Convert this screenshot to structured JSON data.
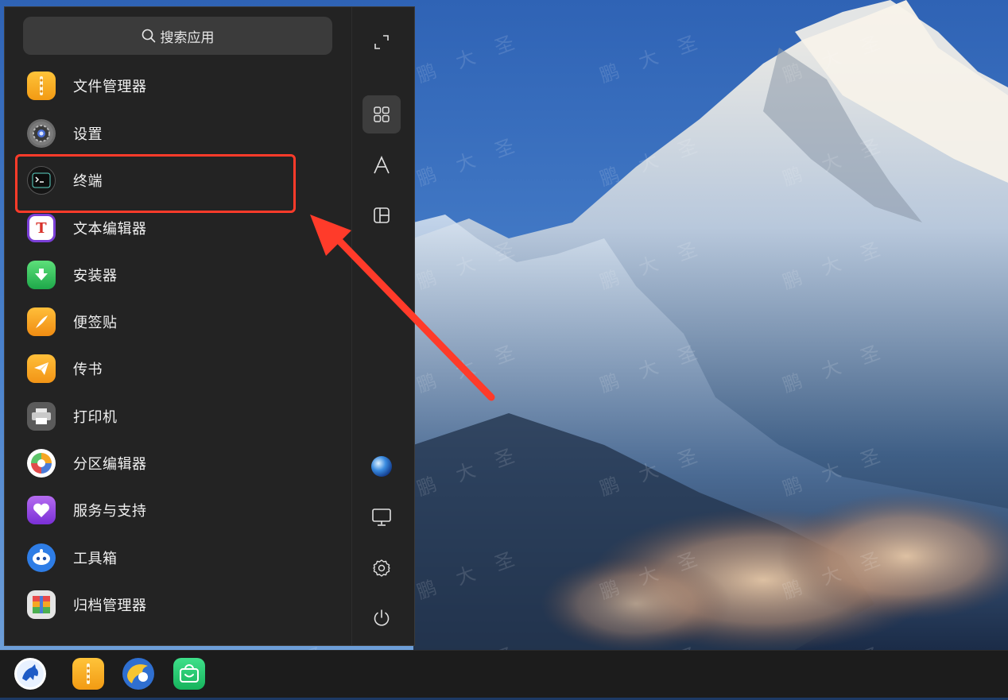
{
  "search": {
    "placeholder": "搜索应用"
  },
  "apps": [
    {
      "label": "文件管理器",
      "icon": "file-manager-icon"
    },
    {
      "label": "设置",
      "icon": "settings-app-icon"
    },
    {
      "label": "终端",
      "icon": "terminal-icon"
    },
    {
      "label": "文本编辑器",
      "icon": "text-editor-icon"
    },
    {
      "label": "安装器",
      "icon": "installer-icon"
    },
    {
      "label": "便签贴",
      "icon": "sticky-notes-icon"
    },
    {
      "label": "传书",
      "icon": "transfer-icon"
    },
    {
      "label": "打印机",
      "icon": "printer-icon"
    },
    {
      "label": "分区编辑器",
      "icon": "partition-editor-icon"
    },
    {
      "label": "服务与支持",
      "icon": "service-support-icon"
    },
    {
      "label": "工具箱",
      "icon": "toolbox-icon"
    },
    {
      "label": "归档管理器",
      "icon": "archive-manager-icon"
    }
  ],
  "side_buttons": [
    {
      "name": "fullscreen",
      "icon": "expand-icon"
    },
    {
      "name": "all-apps",
      "icon": "grid-icon",
      "active": true
    },
    {
      "name": "letter-sort",
      "icon": "letter-a-icon"
    },
    {
      "name": "category",
      "icon": "category-icon"
    },
    {
      "name": "user-avatar",
      "icon": "avatar-icon"
    },
    {
      "name": "computer",
      "icon": "monitor-icon"
    },
    {
      "name": "system-settings",
      "icon": "gear-icon"
    },
    {
      "name": "power",
      "icon": "power-icon"
    }
  ],
  "highlighted_app": "终端",
  "taskbar": {
    "items": [
      {
        "name": "start-menu",
        "icon": "kylin-logo-icon"
      },
      {
        "name": "file-manager",
        "icon": "file-manager-icon"
      },
      {
        "name": "browser",
        "icon": "browser-icon"
      },
      {
        "name": "app-store",
        "icon": "app-store-icon"
      }
    ]
  },
  "watermark": {
    "text": "鹏大圣"
  },
  "colors": {
    "highlight": "#ff3b2a",
    "menu_bg": "#232323",
    "taskbar_bg": "#1c1c1c"
  }
}
